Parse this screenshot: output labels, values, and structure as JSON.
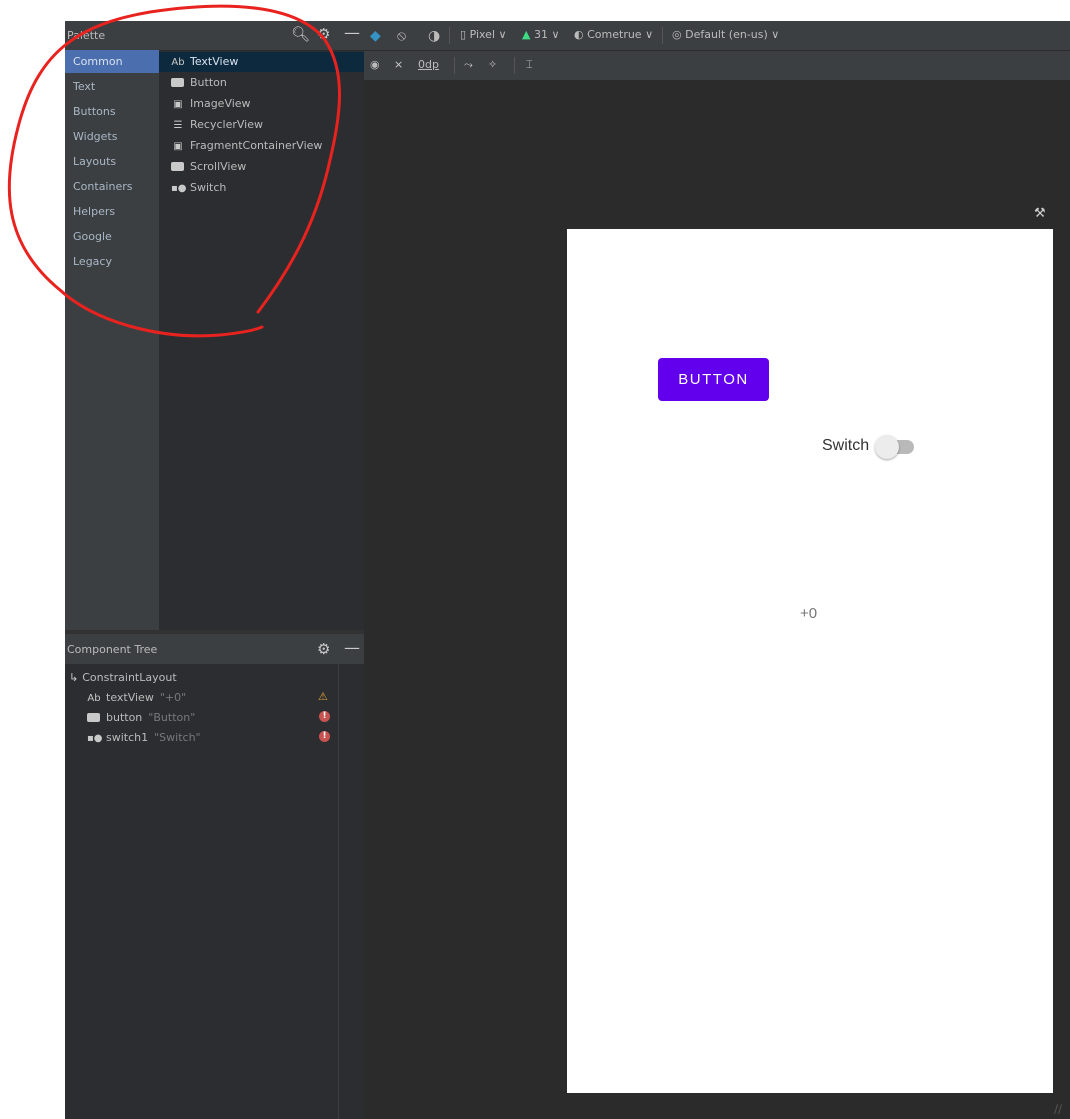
{
  "palette": {
    "title": "Palette",
    "categories": [
      "Common",
      "Text",
      "Buttons",
      "Widgets",
      "Layouts",
      "Containers",
      "Helpers",
      "Google",
      "Legacy"
    ],
    "selected_category": "Common",
    "items": [
      {
        "icon": "Ab",
        "label": "TextView"
      },
      {
        "icon": "button-icon",
        "label": "Button"
      },
      {
        "icon": "image-icon",
        "label": "ImageView"
      },
      {
        "icon": "list-icon",
        "label": "RecyclerView"
      },
      {
        "icon": "fragment-icon",
        "label": "FragmentContainerView"
      },
      {
        "icon": "scroll-icon",
        "label": "ScrollView"
      },
      {
        "icon": "switch-icon",
        "label": "Switch"
      }
    ],
    "selected_item": "TextView"
  },
  "component_tree": {
    "title": "Component Tree",
    "root": "ConstraintLayout",
    "rows": [
      {
        "icon": "Ab",
        "id": "textView",
        "text": "\"+0\"",
        "status": "warning"
      },
      {
        "icon": "button-icon",
        "id": "button",
        "text": "\"Button\"",
        "status": "error"
      },
      {
        "icon": "switch-icon",
        "id": "switch1",
        "text": "\"Switch\"",
        "status": "error"
      }
    ]
  },
  "toolbar": {
    "device": "Pixel",
    "api": "31",
    "theme": "Cometrue",
    "locale": "Default (en-us)",
    "margin": "0dp"
  },
  "device_preview": {
    "button_label": "BUTTON",
    "switch_label": "Switch",
    "text_value": "+0",
    "button_color": "#6200ee"
  },
  "colors": {
    "panel": "#3c3f41",
    "canvas": "#2b2b2b",
    "selection": "#4b6eaf",
    "annotation": "#e8231f"
  }
}
